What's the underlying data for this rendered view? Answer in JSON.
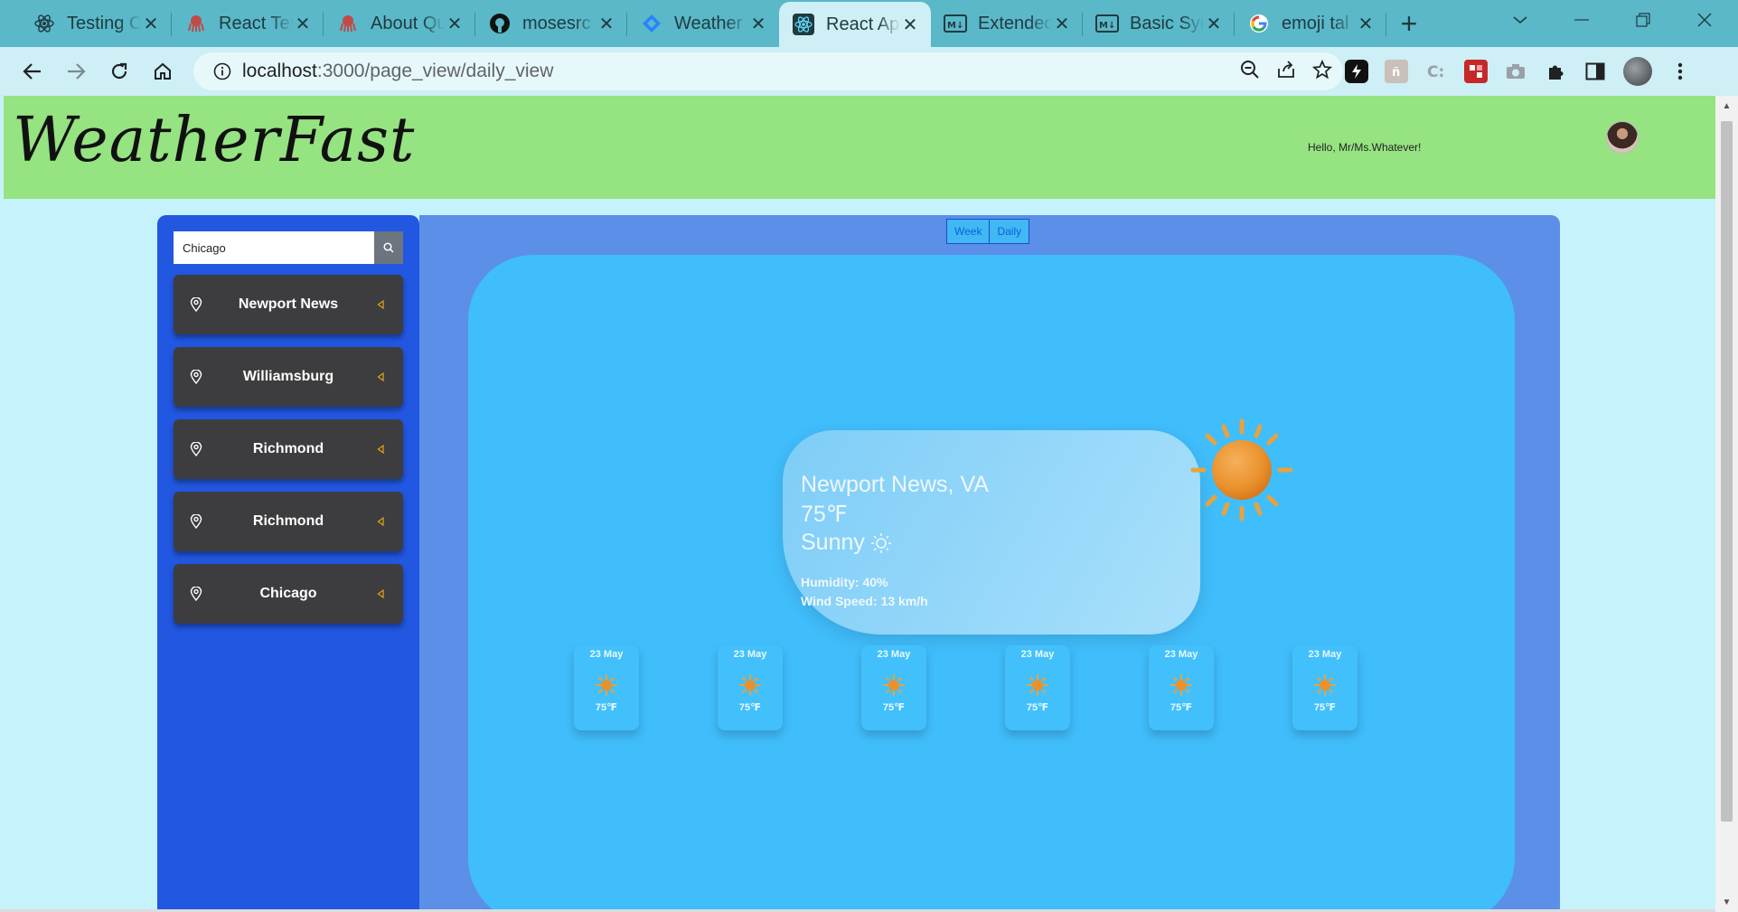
{
  "browser": {
    "tabs": [
      {
        "title": "Testing C",
        "icon": "react-icon"
      },
      {
        "title": "React Tes",
        "icon": "octopus-icon"
      },
      {
        "title": "About Qu",
        "icon": "octopus-icon"
      },
      {
        "title": "mosesrc",
        "icon": "github-icon"
      },
      {
        "title": "Weather",
        "icon": "jira-icon"
      },
      {
        "title": "React Ap",
        "icon": "react-icon",
        "active": true
      },
      {
        "title": "Extended",
        "icon": "markdown-icon"
      },
      {
        "title": "Basic Syn",
        "icon": "markdown-icon"
      },
      {
        "title": "emoji tal",
        "icon": "google-icon"
      }
    ],
    "url_host": "localhost",
    "url_rest": ":3000/page_view/daily_view"
  },
  "header": {
    "brand": "WeatherFast",
    "greeting": "Hello, Mr/Ms.Whatever!"
  },
  "sidebar": {
    "search_value": "Chicago",
    "locations": [
      {
        "name": "Newport News"
      },
      {
        "name": "Williamsburg"
      },
      {
        "name": "Richmond"
      },
      {
        "name": "Richmond"
      },
      {
        "name": "Chicago"
      }
    ]
  },
  "view_toggle": {
    "week": "Week",
    "daily": "Daily"
  },
  "current": {
    "city": "Newport News, VA",
    "temp": "75℉",
    "condition": "Sunny",
    "humidity": "Humidity: 40%",
    "wind": "Wind Speed: 13 km/h"
  },
  "forecast": [
    {
      "date": "23 May",
      "temp": "75℉"
    },
    {
      "date": "23 May",
      "temp": "75℉"
    },
    {
      "date": "23 May",
      "temp": "75℉"
    },
    {
      "date": "23 May",
      "temp": "75℉"
    },
    {
      "date": "23 May",
      "temp": "75℉"
    },
    {
      "date": "23 May",
      "temp": "75℉"
    }
  ],
  "colors": {
    "header_bg": "#95e381",
    "sidebar_bg": "#2257e1",
    "main_bg": "#5b8fe8",
    "panel_bg": "#40bdfb",
    "location_bg": "#3d3d3f",
    "accent_caret": "#d4a017"
  }
}
